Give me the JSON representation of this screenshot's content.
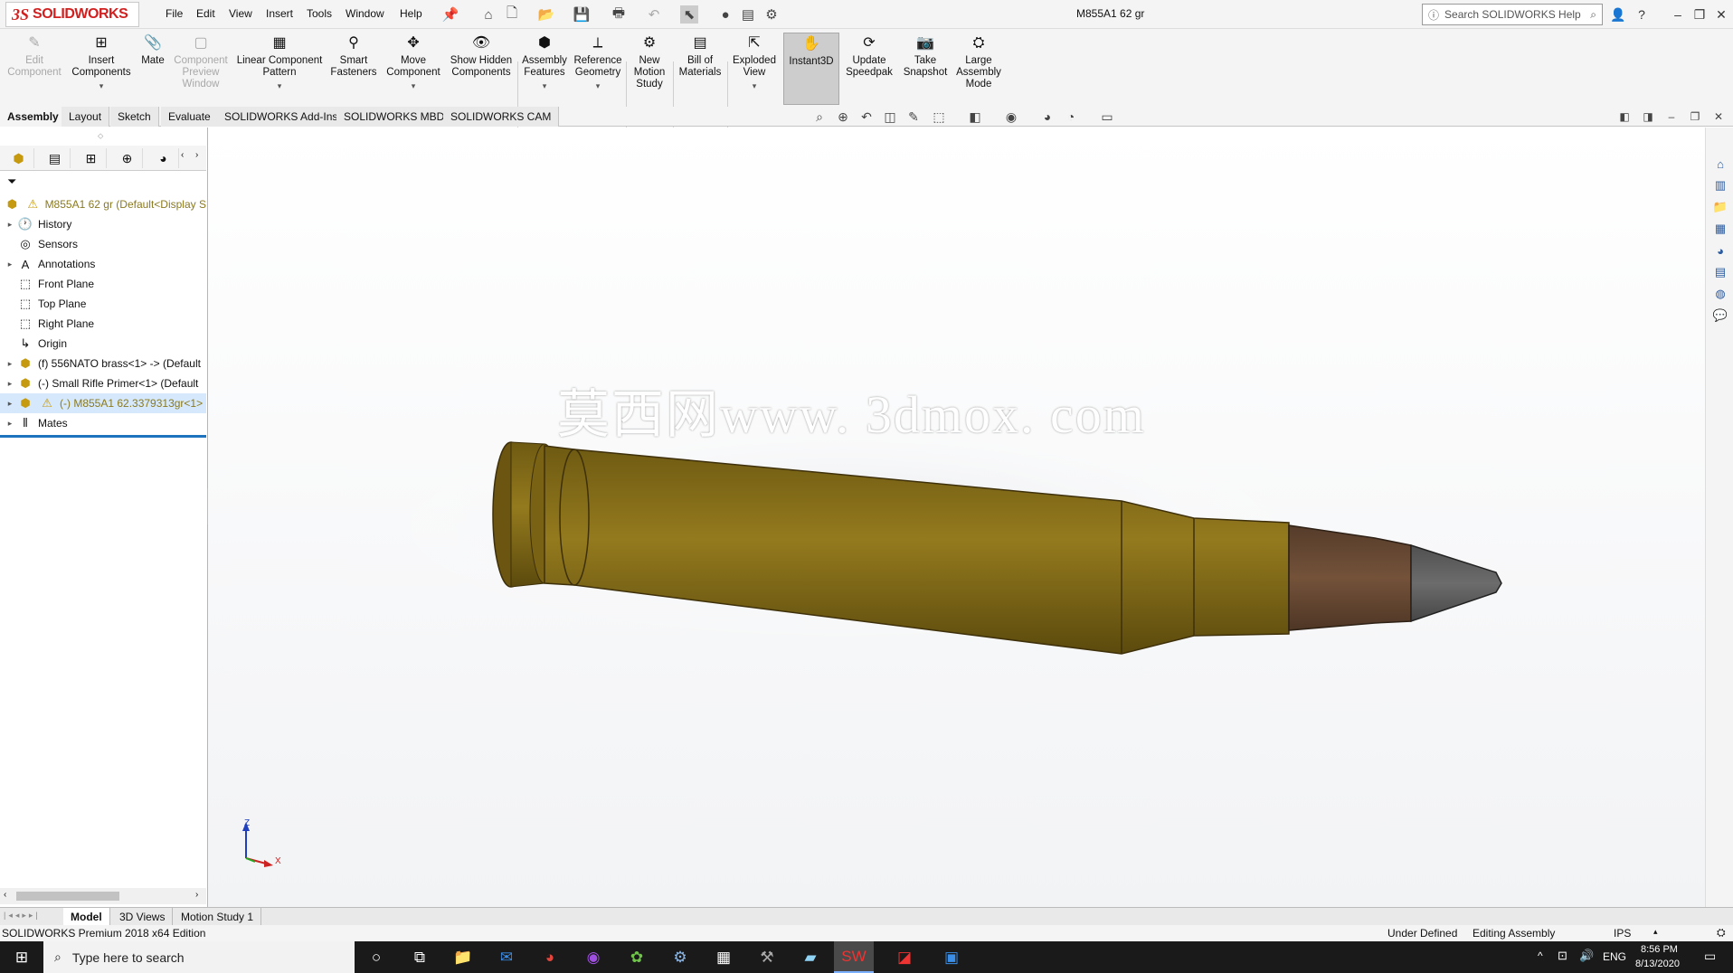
{
  "app": {
    "logo_ds": "3S",
    "logo_name": "SOLIDWORKS",
    "doc_title": "M855A1 62 gr",
    "menus": [
      "File",
      "Edit",
      "View",
      "Insert",
      "Tools",
      "Window",
      "Help"
    ],
    "search_placeholder": "Search SOLIDWORKS Help"
  },
  "ribbon": {
    "tools": [
      {
        "label": "Edit Component",
        "disabled": true,
        "icon": "edit-component-icon"
      },
      {
        "label": "Insert Components",
        "icon": "insert-components-icon",
        "dropdown": true
      },
      {
        "label": "Mate",
        "icon": "mate-icon"
      },
      {
        "label": "Component Preview Window",
        "disabled": true,
        "icon": "component-preview-icon"
      },
      {
        "label": "Linear Component Pattern",
        "icon": "linear-pattern-icon",
        "dropdown": true
      },
      {
        "label": "Smart Fasteners",
        "icon": "smart-fasteners-icon"
      },
      {
        "label": "Move Component",
        "icon": "move-component-icon",
        "dropdown": true
      },
      {
        "label": "Show Hidden Components",
        "icon": "show-hidden-icon"
      },
      {
        "label": "Assembly Features",
        "icon": "assembly-features-icon",
        "dropdown": true
      },
      {
        "label": "Reference Geometry",
        "icon": "reference-geometry-icon",
        "dropdown": true
      },
      {
        "label": "New Motion Study",
        "icon": "motion-study-icon"
      },
      {
        "label": "Bill of Materials",
        "icon": "bom-icon"
      },
      {
        "label": "Exploded View",
        "icon": "exploded-view-icon",
        "dropdown": true
      },
      {
        "label": "Instant3D",
        "icon": "instant3d-icon",
        "active": true
      },
      {
        "label": "Update Speedpak",
        "icon": "speedpak-icon"
      },
      {
        "label": "Take Snapshot",
        "icon": "snapshot-icon"
      },
      {
        "label": "Large Assembly Mode",
        "icon": "large-assembly-icon"
      }
    ]
  },
  "tabs": [
    "Assembly",
    "Layout",
    "Sketch",
    "Evaluate",
    "SOLIDWORKS Add-Ins",
    "SOLIDWORKS MBD",
    "SOLIDWORKS CAM"
  ],
  "tree": {
    "root": "M855A1 62 gr  (Default<Display S",
    "items": [
      {
        "label": "History",
        "expand": true
      },
      {
        "label": "Sensors",
        "expand": false
      },
      {
        "label": "Annotations",
        "expand": true
      },
      {
        "label": "Front Plane",
        "expand": false
      },
      {
        "label": "Top Plane",
        "expand": false
      },
      {
        "label": "Right Plane",
        "expand": false
      },
      {
        "label": "Origin",
        "expand": false
      },
      {
        "label": "(f) 556NATO brass<1> -> (Default",
        "expand": true
      },
      {
        "label": "(-) Small Rifle Primer<1> (Default",
        "expand": true
      },
      {
        "label": "(-) M855A1 62.3379313gr<1>",
        "expand": true,
        "selected": true
      },
      {
        "label": "Mates",
        "expand": true
      }
    ]
  },
  "watermark": "莫西网www. 3dmox. com",
  "triad": {
    "z": "Z",
    "x": "X"
  },
  "bottom_tabs": [
    "Model",
    "3D Views",
    "Motion Study 1"
  ],
  "status": {
    "edition": "SOLIDWORKS Premium 2018 x64 Edition",
    "state": "Under Defined",
    "mode": "Editing Assembly",
    "units": "IPS"
  },
  "taskbar": {
    "search": "Type here to search",
    "lang": "ENG",
    "time": "8:56 PM",
    "date": "8/13/2020"
  },
  "colors": {
    "brass": "#8a6f1a",
    "bullet_copper": "#6b4a32",
    "tip_steel": "#585858",
    "accent": "#d12020"
  }
}
